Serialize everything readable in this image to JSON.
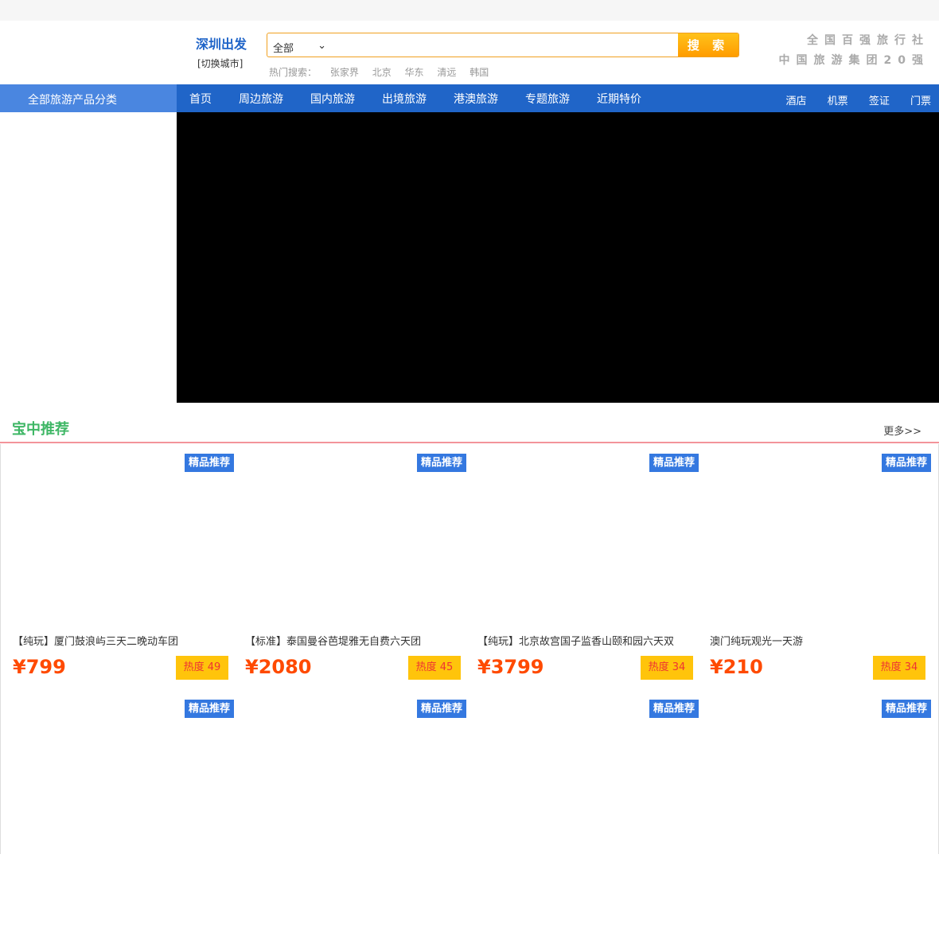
{
  "header": {
    "city": "深圳出发",
    "switch_city": "[切换城市]",
    "search_category": "全部",
    "search_button": "搜 索",
    "hot_label": "热门搜索：",
    "hot_terms": [
      "张家界",
      "北京",
      "华东",
      "清远",
      "韩国"
    ],
    "slogan1": "全国百强旅行社",
    "slogan2": "中国旅游集团20强"
  },
  "nav": {
    "all_categories": "全部旅游产品分类",
    "items": [
      "首页",
      "周边旅游",
      "国内旅游",
      "出境旅游",
      "港澳旅游",
      "专题旅游",
      "近期特价"
    ],
    "right": [
      "酒店",
      "机票",
      "签证",
      "门票"
    ]
  },
  "section": {
    "title": "宝中推荐",
    "more": "更多>>"
  },
  "products": [
    {
      "badge": "精品推荐",
      "title": "【纯玩】厦门鼓浪屿三天二晚动车团",
      "price": "¥799",
      "heat": "热度 49"
    },
    {
      "badge": "精品推荐",
      "title": "【标准】泰国曼谷芭堤雅无自费六天团",
      "price": "¥2080",
      "heat": "热度 45"
    },
    {
      "badge": "精品推荐",
      "title": "【纯玩】北京故宫国子监香山颐和园六天双",
      "price": "¥3799",
      "heat": "热度 34"
    },
    {
      "badge": "精品推荐",
      "title": "澳门纯玩观光一天游",
      "price": "¥210",
      "heat": "热度 34"
    },
    {
      "badge": "精品推荐"
    },
    {
      "badge": "精品推荐"
    },
    {
      "badge": "精品推荐"
    },
    {
      "badge": "精品推荐"
    }
  ]
}
